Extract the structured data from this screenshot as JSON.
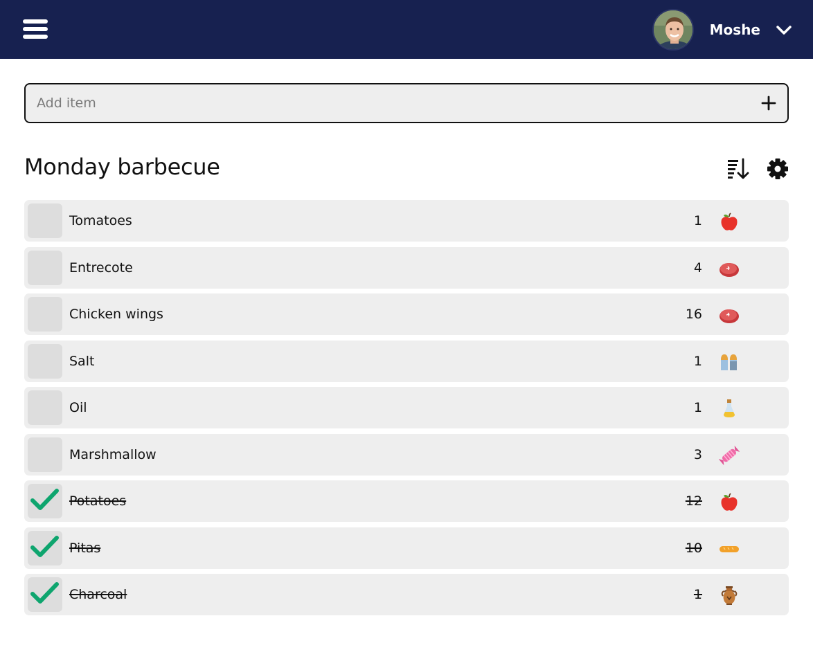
{
  "header": {
    "username": "Moshe"
  },
  "add_item": {
    "placeholder": "Add item"
  },
  "list": {
    "title": "Monday barbecue",
    "items": [
      {
        "name": "Tomatoes",
        "quantity": "1",
        "checked": false,
        "icon": "apple-icon"
      },
      {
        "name": "Entrecote",
        "quantity": "4",
        "checked": false,
        "icon": "meat-icon"
      },
      {
        "name": "Chicken wings",
        "quantity": "16",
        "checked": false,
        "icon": "meat-icon"
      },
      {
        "name": "Salt",
        "quantity": "1",
        "checked": false,
        "icon": "salt-shaker-icon"
      },
      {
        "name": "Oil",
        "quantity": "1",
        "checked": false,
        "icon": "oil-bottle-icon"
      },
      {
        "name": "Marshmallow",
        "quantity": "3",
        "checked": false,
        "icon": "candy-icon"
      },
      {
        "name": "Potatoes",
        "quantity": "12",
        "checked": true,
        "icon": "apple-icon"
      },
      {
        "name": "Pitas",
        "quantity": "10",
        "checked": true,
        "icon": "bread-icon"
      },
      {
        "name": "Charcoal",
        "quantity": "1",
        "checked": true,
        "icon": "amphora-icon"
      }
    ]
  },
  "colors": {
    "topbar": "#172150",
    "row_background": "#eeeeee",
    "checkbox_background": "#dddddd",
    "check_mark": "#0ea56e"
  }
}
